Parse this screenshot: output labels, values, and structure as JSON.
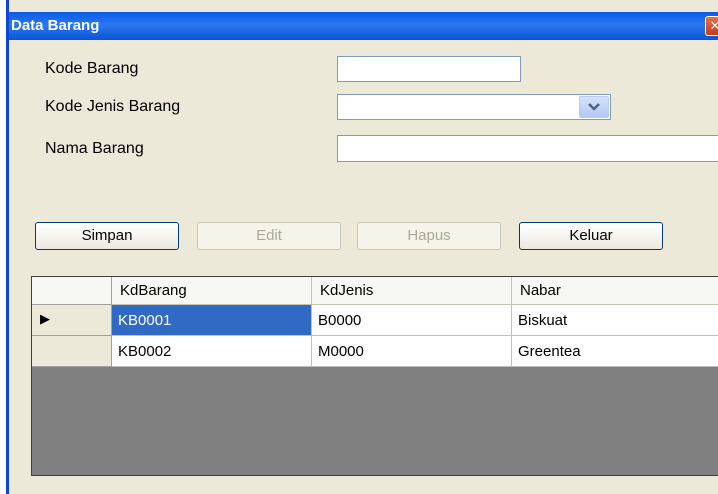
{
  "window": {
    "title": "Data Barang",
    "close_icon": "close-icon"
  },
  "form": {
    "kode_barang_label": "Kode Barang",
    "kode_barang_value": "",
    "kode_jenis_label": "Kode Jenis Barang",
    "kode_jenis_value": "",
    "nama_barang_label": "Nama Barang",
    "nama_barang_value": ""
  },
  "buttons": {
    "simpan": "Simpan",
    "edit": "Edit",
    "hapus": "Hapus",
    "keluar": "Keluar"
  },
  "grid": {
    "columns": [
      "KdBarang",
      "KdJenis",
      "Nabar"
    ],
    "rows": [
      [
        "KB0001",
        "B0000",
        "Biskuat"
      ],
      [
        "KB0002",
        "M0000",
        "Greentea"
      ]
    ],
    "current_row_indicator": "▶"
  },
  "colors": {
    "titlebar": "#0a5ae6",
    "selection": "#316ac5",
    "grid_background": "#808080"
  }
}
